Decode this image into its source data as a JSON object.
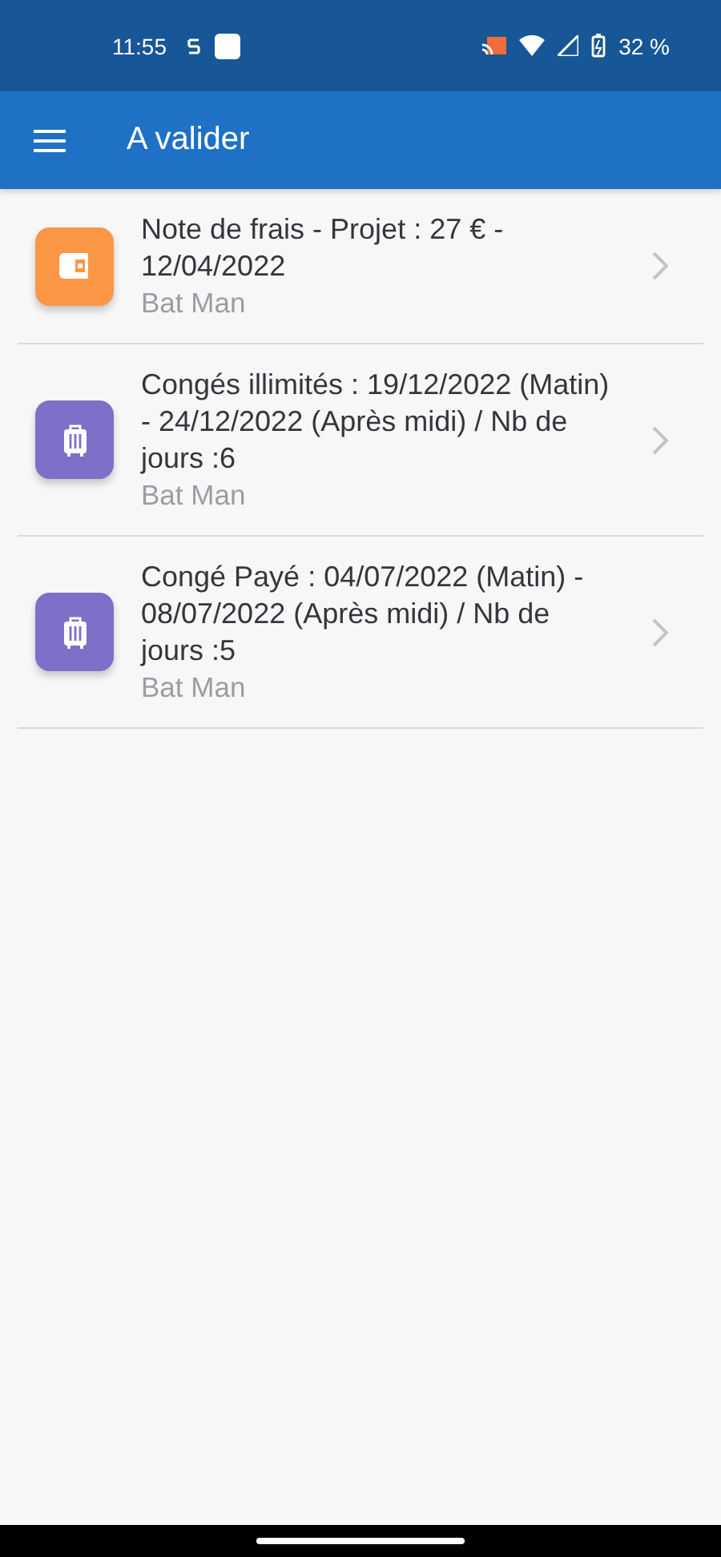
{
  "status_bar": {
    "time": "11:55",
    "battery": "32 %"
  },
  "app_bar": {
    "title": "A valider"
  },
  "requests": [
    {
      "kind": "expense",
      "color": "#fb9645",
      "title": "Note de frais - Projet : 27 €  - 12/04/2022",
      "author": "Bat Man"
    },
    {
      "kind": "leave",
      "color": "#7f6fc9",
      "title": "Congés illimités : 19/12/2022 (Matin) - 24/12/2022 (Après midi) / Nb de jours :6",
      "author": "Bat Man"
    },
    {
      "kind": "leave",
      "color": "#7f6fc9",
      "title": "Congé Payé : 04/07/2022 (Matin) - 08/07/2022 (Après midi) / Nb de jours :5",
      "author": "Bat Man"
    }
  ]
}
